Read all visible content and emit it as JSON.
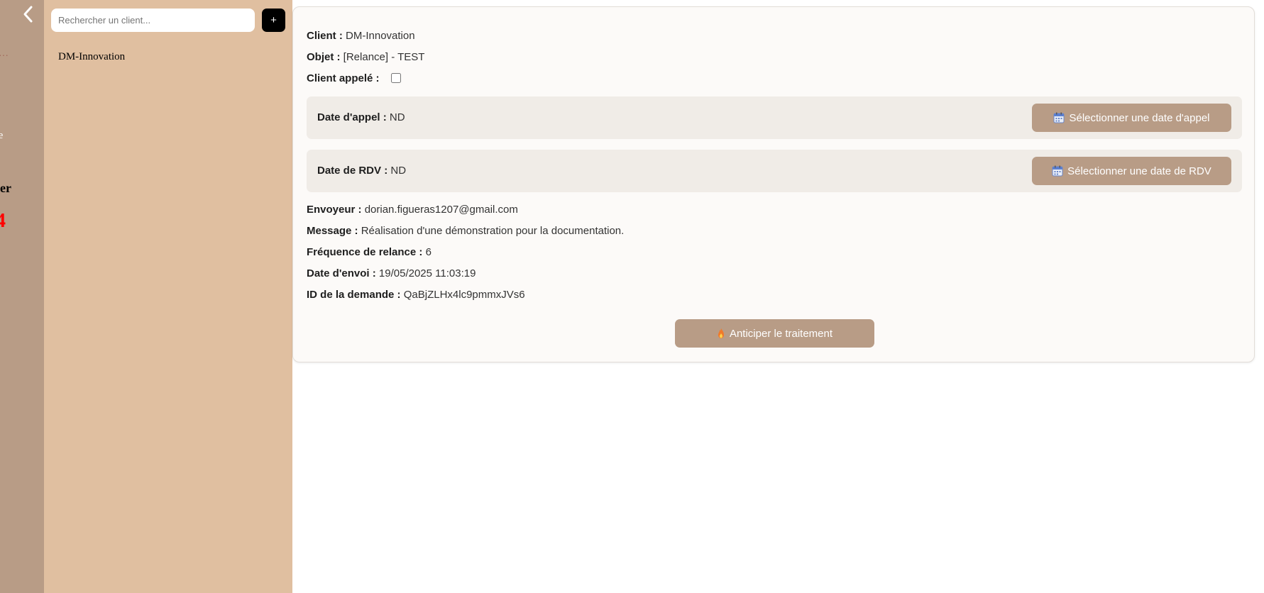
{
  "rail": {
    "back_icon": "chevron-left-icon",
    "fragments": [
      "…",
      "me",
      "raiter",
      "4",
      "e"
    ]
  },
  "client_panel": {
    "search_placeholder": "Rechercher un client...",
    "add_label": "+",
    "clients": [
      "DM-Innovation"
    ]
  },
  "detail": {
    "client_label": "Client :",
    "client_value": "DM-Innovation",
    "object_label": "Objet :",
    "object_value": "[Relance] - TEST",
    "called_label": "Client appelé :",
    "called_checked": false,
    "call_date_label": "Date d'appel :",
    "call_date_value": "ND",
    "call_date_button": "Sélectionner une date d'appel",
    "rdv_date_label": "Date de RDV :",
    "rdv_date_value": "ND",
    "rdv_date_button": "Sélectionner une date de RDV",
    "sender_label": "Envoyeur :",
    "sender_value": "dorian.figueras1207@gmail.com",
    "message_label": "Message :",
    "message_value": "Réalisation d'une démonstration pour la documentation.",
    "frequency_label": "Fréquence de relance :",
    "frequency_value": "6",
    "send_date_label": "Date d'envoi :",
    "send_date_value": "19/05/2025 11:03:19",
    "request_id_label": "ID de la demande :",
    "request_id_value": "QaBjZLHx4lc9pmmxJVs6",
    "anticipate_button": "Anticiper le traitement"
  },
  "colors": {
    "rail": "#b89c86",
    "panel": "#e0bfa0",
    "button": "#b89c86",
    "card": "#fcfaf8",
    "date_box": "#f0ece7",
    "alert": "#ff0000"
  },
  "icons": {
    "calendar": "calendar-icon",
    "flame": "flame-icon"
  }
}
